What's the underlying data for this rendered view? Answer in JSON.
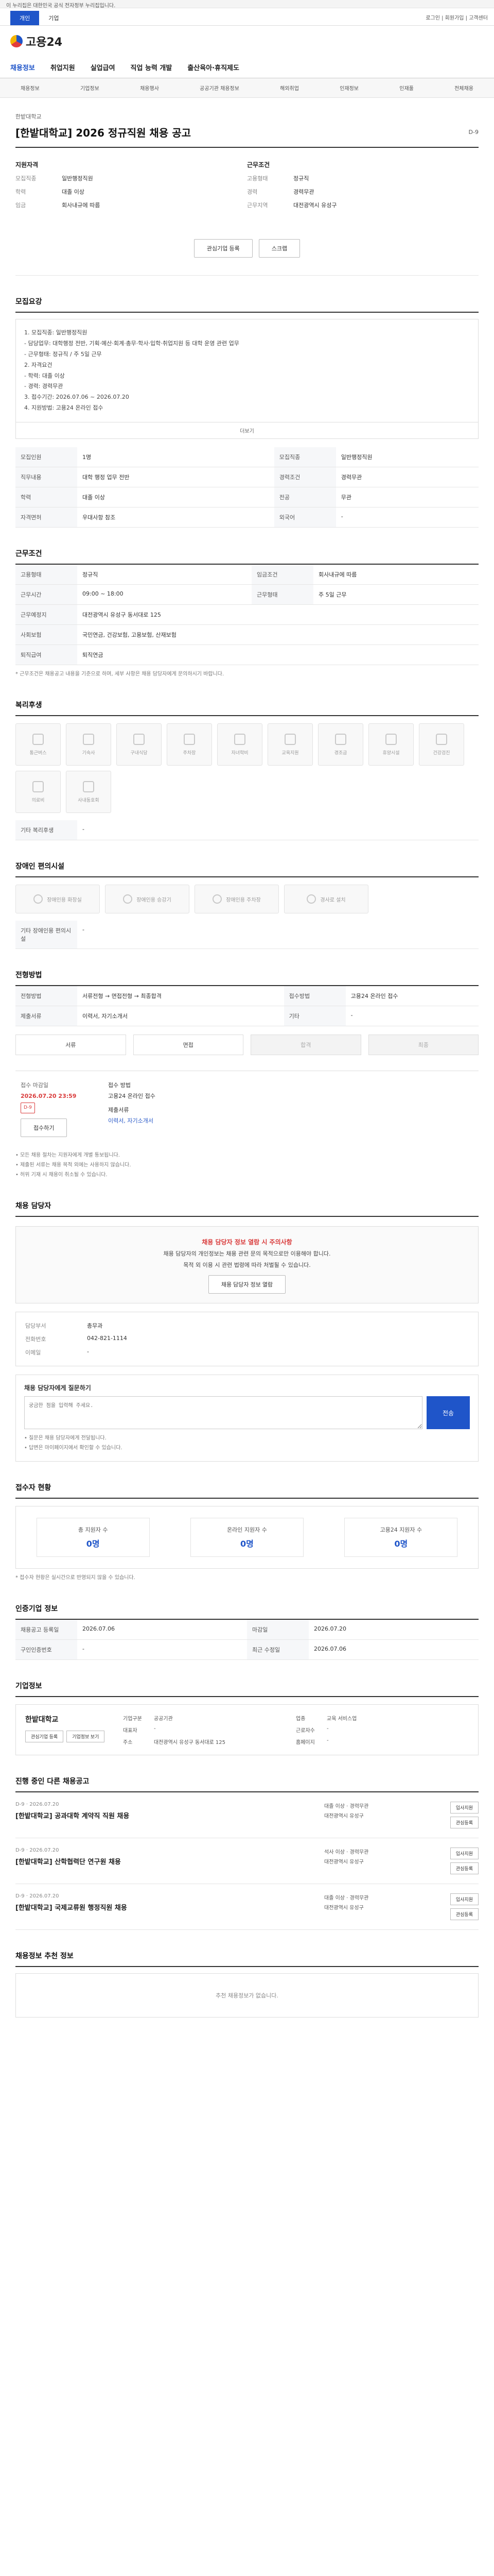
{
  "gov_banner": {
    "text": "이 누리집은 대한민국 공식 전자정부 누리집입니다."
  },
  "topbar": {
    "tabs": [
      "개인",
      "기업"
    ],
    "active": "개인",
    "right_text": "로그인 | 회원가입 | 고객센터"
  },
  "brand": {
    "logo_text": "고용24"
  },
  "gnb": {
    "items": [
      "채용정보",
      "취업지원",
      "실업급여",
      "직업 능력 개발",
      "출산육아·휴직제도"
    ]
  },
  "subnav": {
    "items": [
      "채용정보",
      "기업정보",
      "채용행사",
      "공공기관 채용정보",
      "해외취업",
      "인재정보",
      "인재풀",
      "전체채용"
    ]
  },
  "job": {
    "company": "한밭대학교",
    "title": "[한밭대학교] 2026 정규직원 채용 공고",
    "dday": "D-9",
    "summary": [
      {
        "label": "모집직종",
        "value": "일반행정직원"
      },
      {
        "label": "고용형태",
        "value": "정규직"
      },
      {
        "label": "학력",
        "value": "대졸 이상"
      },
      {
        "label": "경력",
        "value": "경력무관"
      },
      {
        "label": "임금",
        "value": "회사내규에 따름"
      },
      {
        "label": "근무지역",
        "value": "대전광역시 유성구"
      }
    ],
    "summary_heads": [
      "지원자격",
      "근무조건"
    ],
    "buttons": {
      "interest": "관심기업 등록",
      "scrap": "스크랩"
    }
  },
  "sections": {
    "recruit": "모집요강",
    "conditions": "근무조건",
    "welfare": "복리후생",
    "disabled": "장애인 편의시설",
    "apply": "전형방법",
    "contact": "채용 담당자",
    "applicant_status": "접수자 현황",
    "info": "인증기업 정보",
    "company": "기업정보",
    "other": "진행 중인 다른 채용공고",
    "recommend": "채용정보 추천 정보"
  },
  "recruit_text": [
    "1. 모집직종: 일반행정직원",
    "- 담당업무: 대학행정 전반, 기획·예산·회계·총무·학사·입학·취업지원 등 대학 운영 관련 업무",
    "- 근무형태: 정규직 / 주 5일 근무",
    "2. 자격요건",
    "- 학력: 대졸 이상",
    "- 경력: 경력무관",
    "3. 접수기간: 2026.07.06 ~ 2026.07.20",
    "4. 지원방법: 고용24 온라인 접수"
  ],
  "more_label": "더보기",
  "recruit_table": [
    {
      "label": "모집인원",
      "value": "1명"
    },
    {
      "label": "모집직종",
      "value": "일반행정직원"
    },
    {
      "label": "직무내용",
      "value": "대학 행정 업무 전반"
    },
    {
      "label": "경력조건",
      "value": "경력무관"
    },
    {
      "label": "학력",
      "value": "대졸 이상"
    },
    {
      "label": "전공",
      "value": "무관"
    },
    {
      "label": "자격면허",
      "value": "우대사항 참조"
    },
    {
      "label": "외국어",
      "value": "-"
    }
  ],
  "conditions_table": [
    {
      "label": "고용형태",
      "value": "정규직"
    },
    {
      "label": "임금조건",
      "value": "회사내규에 따름"
    },
    {
      "label": "근무시간",
      "value": "09:00 ~ 18:00"
    },
    {
      "label": "근무형태",
      "value": "주 5일 근무"
    },
    {
      "label": "근무예정지",
      "value": "대전광역시 유성구 동서대로 125"
    },
    {
      "label": "사회보험",
      "value": "국민연금, 건강보험, 고용보험, 산재보험"
    },
    {
      "label": "퇴직급여",
      "value": "퇴직연금"
    }
  ],
  "conditions_note": "* 근무조건은 채용공고 내용을 기준으로 하며, 세부 사항은 채용 담당자에게 문의하시기 바랍니다.",
  "welfare_items": [
    "통근버스",
    "기숙사",
    "구내식당",
    "주차장",
    "자녀학비",
    "교육지원",
    "경조금",
    "휴양시설",
    "건강검진",
    "의료비",
    "사내동호회"
  ],
  "welfare_etc": {
    "label": "기타 복리후생",
    "value": "-"
  },
  "disabled_items": [
    "장애인용 화장실",
    "장애인용 승강기",
    "장애인용 주차장",
    "경사로 설치"
  ],
  "disabled_etc": {
    "label": "기타 장애인용 편의시설",
    "value": "-"
  },
  "apply_table": [
    {
      "label": "전형방법",
      "value": "서류전형 → 면접전형 → 최종합격"
    },
    {
      "label": "접수방법",
      "value": "고용24 온라인 접수"
    },
    {
      "label": "제출서류",
      "value": "이력서, 자기소개서"
    },
    {
      "label": "기타",
      "value": "-"
    }
  ],
  "steps": [
    "서류",
    "면접",
    "합격",
    "최종"
  ],
  "deadline": {
    "label": "접수 마감일",
    "date": "2026.07.20 23:59",
    "tag": "D-9",
    "method_label": "접수 방법",
    "method": "고용24 온라인 접수",
    "docs_label": "제출서류",
    "docs": "이력서, 자기소개서",
    "button": "접수하기"
  },
  "apply_notes": [
    "• 모든 채용 절차는 지원자에게 개별 통보됩니다.",
    "• 제출된 서류는 채용 목적 외에는 사용하지 않습니다.",
    "• 허위 기재 시 채용이 취소될 수 있습니다."
  ],
  "warn": {
    "title": "채용 담당자 정보 열람 시 주의사항",
    "lines": [
      "채용 담당자의 개인정보는 채용 관련 문의 목적으로만 이용해야 합니다.",
      "목적 외 이용 시 관련 법령에 따라 처벌될 수 있습니다."
    ],
    "button": "채용 담당자 정보 열람"
  },
  "contact": [
    {
      "label": "담당부서",
      "value": "총무과"
    },
    {
      "label": "전화번호",
      "value": "042-821-1114"
    },
    {
      "label": "이메일",
      "value": "-"
    }
  ],
  "qa": {
    "title": "채용 담당자에게 질문하기",
    "placeholder": "궁금한 점을 입력해 주세요.",
    "button": "전송",
    "notes": [
      "• 질문은 채용 담당자에게 전달됩니다.",
      "• 답변은 마이페이지에서 확인할 수 있습니다."
    ]
  },
  "status": [
    {
      "label": "총 지원자 수",
      "value": "0명"
    },
    {
      "label": "온라인 지원자 수",
      "value": "0명"
    },
    {
      "label": "고용24 지원자 수",
      "value": "0명"
    }
  ],
  "status_note": "* 접수자 현황은 실시간으로 반영되지 않을 수 있습니다.",
  "info_table": [
    {
      "label": "채용공고 등록일",
      "value": "2026.07.06"
    },
    {
      "label": "마감일",
      "value": "2026.07.20"
    },
    {
      "label": "구인인증번호",
      "value": "-"
    },
    {
      "label": "최근 수정일",
      "value": "2026.07.06"
    }
  ],
  "company_info": {
    "name": "한밭대학교",
    "fields": [
      {
        "label": "기업구분",
        "value": "공공기관"
      },
      {
        "label": "업종",
        "value": "교육 서비스업"
      },
      {
        "label": "대표자",
        "value": "-"
      },
      {
        "label": "근로자수",
        "value": "-"
      },
      {
        "label": "주소",
        "value": "대전광역시 유성구 동서대로 125"
      },
      {
        "label": "홈페이지",
        "value": "-"
      }
    ],
    "buttons": [
      "관심기업 등록",
      "기업정보 보기"
    ]
  },
  "other_jobs": [
    {
      "meta": "D-9 · 2026.07.20",
      "name": "[한밭대학교] 공과대학 계약직 직원 채용",
      "detail": [
        "대졸 이상 · 경력무관",
        "대전광역시 유성구"
      ],
      "actions": [
        "입사지원",
        "관심등록"
      ]
    },
    {
      "meta": "D-9 · 2026.07.20",
      "name": "[한밭대학교] 산학협력단 연구원 채용",
      "detail": [
        "석사 이상 · 경력무관",
        "대전광역시 유성구"
      ],
      "actions": [
        "입사지원",
        "관심등록"
      ]
    },
    {
      "meta": "D-9 · 2026.07.20",
      "name": "[한밭대학교] 국제교류원 행정직원 채용",
      "detail": [
        "대졸 이상 · 경력무관",
        "대전광역시 유성구"
      ],
      "actions": [
        "입사지원",
        "관심등록"
      ]
    }
  ],
  "recommend_empty": "추천 채용정보가 없습니다."
}
